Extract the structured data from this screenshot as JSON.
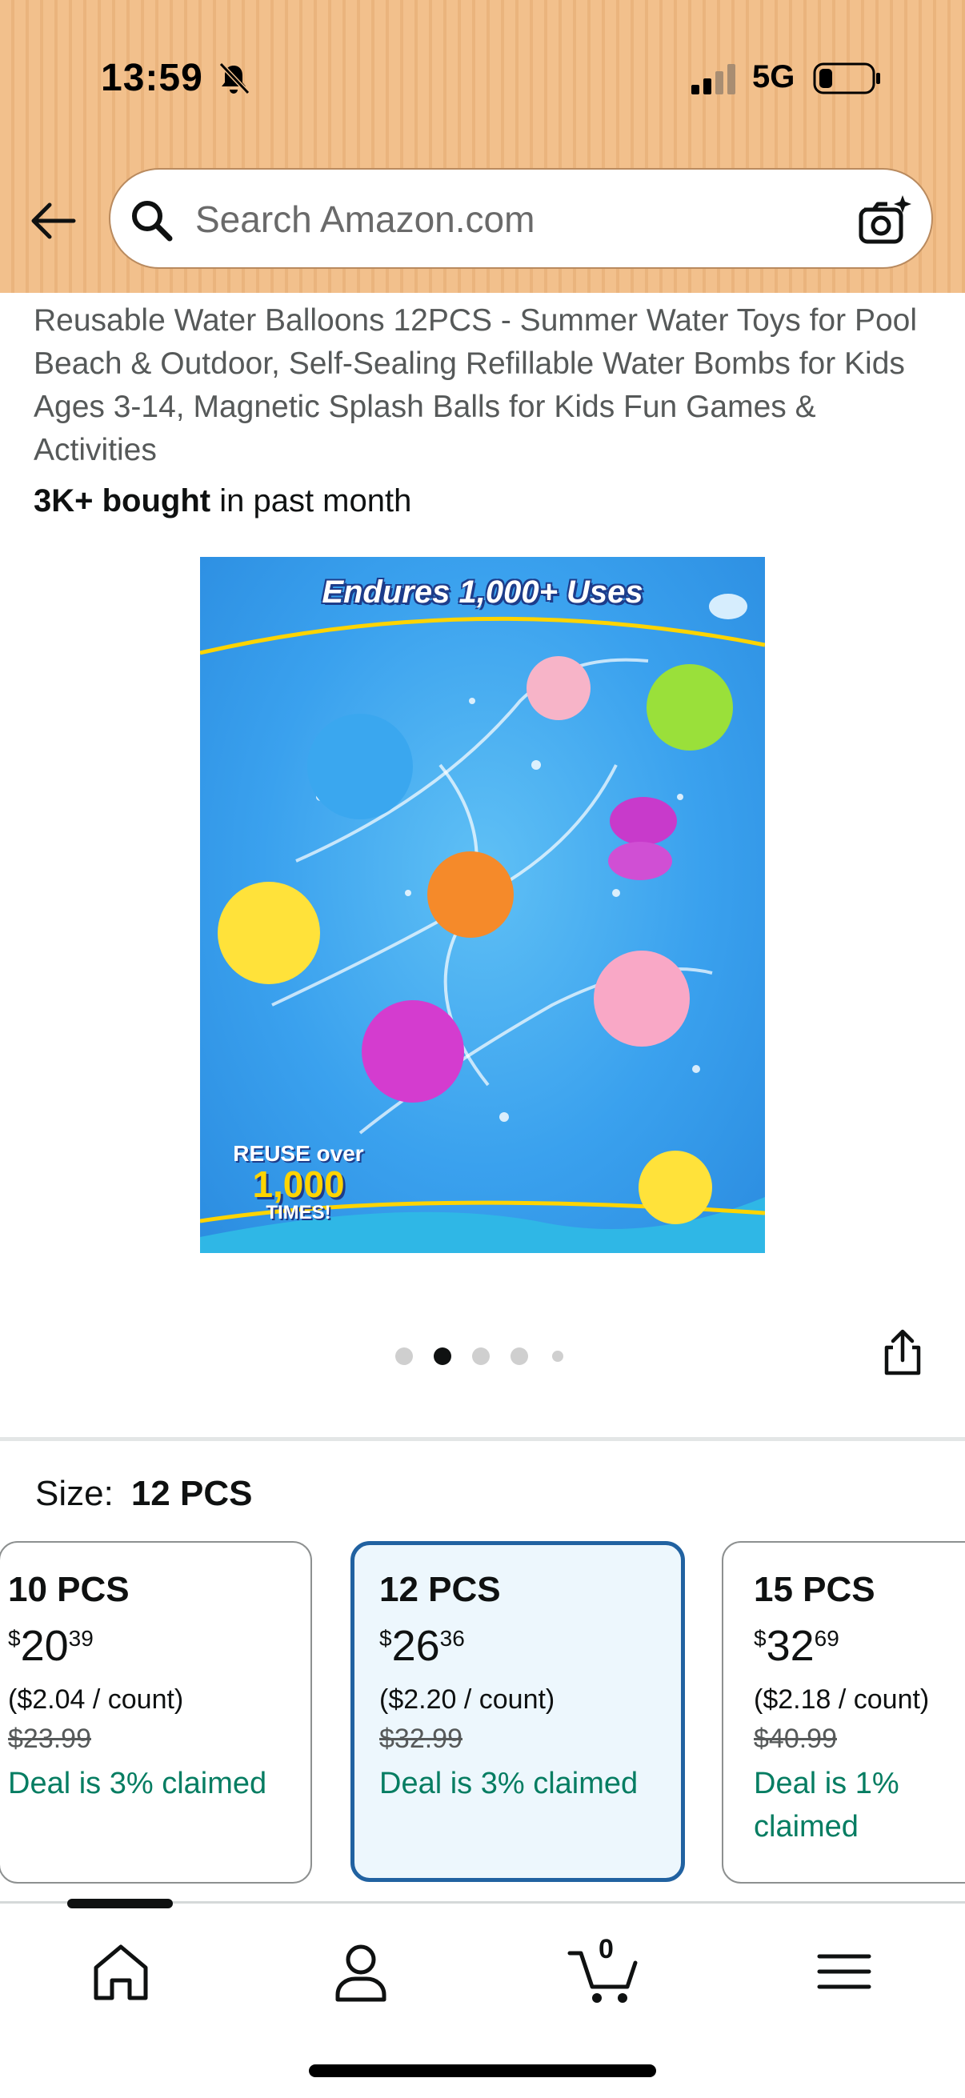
{
  "status_bar": {
    "time": "13:59",
    "network": "5G"
  },
  "search": {
    "placeholder": "Search Amazon.com"
  },
  "product": {
    "title": "Reusable Water Balloons 12PCS - Summer Water Toys for Pool Beach & Outdoor, Self-Sealing Refillable Water Bombs for Kids Ages 3-14, Magnetic Splash Balls for Kids Fun Games & Activities",
    "bought_bold": "3K+ bought",
    "bought_rest": " in past month",
    "image": {
      "headline": "Endures 1,000+ Uses",
      "badge_line1": "REUSE over",
      "badge_line2": "1,000",
      "badge_line3": "TIMES!"
    },
    "carousel": {
      "count": 5,
      "active_index": 1
    }
  },
  "size": {
    "label": "Size:",
    "selected": "12 PCS",
    "options": [
      {
        "name": "10 PCS",
        "price_symbol": "$",
        "price_whole": "20",
        "price_fraction": "39",
        "unit_price": "($2.04 / count)",
        "list_price": "$23.99",
        "deal": "Deal is 3% claimed"
      },
      {
        "name": "12 PCS",
        "price_symbol": "$",
        "price_whole": "26",
        "price_fraction": "36",
        "unit_price": "($2.20 / count)",
        "list_price": "$32.99",
        "deal": "Deal is 3% claimed"
      },
      {
        "name": "15 PCS",
        "price_symbol": "$",
        "price_whole": "32",
        "price_fraction": "69",
        "unit_price": "($2.18 / count)",
        "list_price": "$40.99",
        "deal": "Deal is 1% claimed"
      }
    ]
  },
  "bottom_nav": {
    "items": [
      "home-icon",
      "account-icon",
      "cart-icon",
      "menu-icon"
    ],
    "cart_count": "0"
  },
  "colors": {
    "header_bg": "#f2c08c",
    "deal_green": "#067d62",
    "selected_border": "#2162a1",
    "selected_bg": "#edf7fd"
  }
}
